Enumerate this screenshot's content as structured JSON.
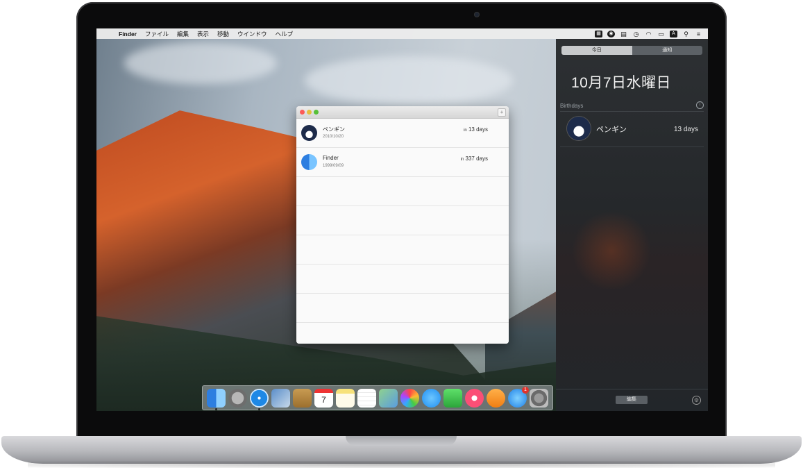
{
  "menubar": {
    "apple_glyph": "",
    "app_name": "Finder",
    "menus": [
      "ファイル",
      "編集",
      "表示",
      "移動",
      "ウインドウ",
      "ヘルプ"
    ]
  },
  "window": {
    "rows": [
      {
        "name": "ペンギン",
        "date": "2010/10/20",
        "days_prefix": "in",
        "days": "13 days"
      },
      {
        "name": "Finder",
        "date": "1999/09/09",
        "days_prefix": "in",
        "days": "337 days"
      }
    ]
  },
  "notification_center": {
    "tabs": [
      "今日",
      "通知"
    ],
    "date": "10月7日水曜日",
    "section_title": "Birthdays",
    "entry": {
      "name": "ペンギン",
      "days": "13 days"
    },
    "edit_label": "編集"
  },
  "dock": {
    "calendar_day": "7",
    "appstore_badge": "1"
  }
}
